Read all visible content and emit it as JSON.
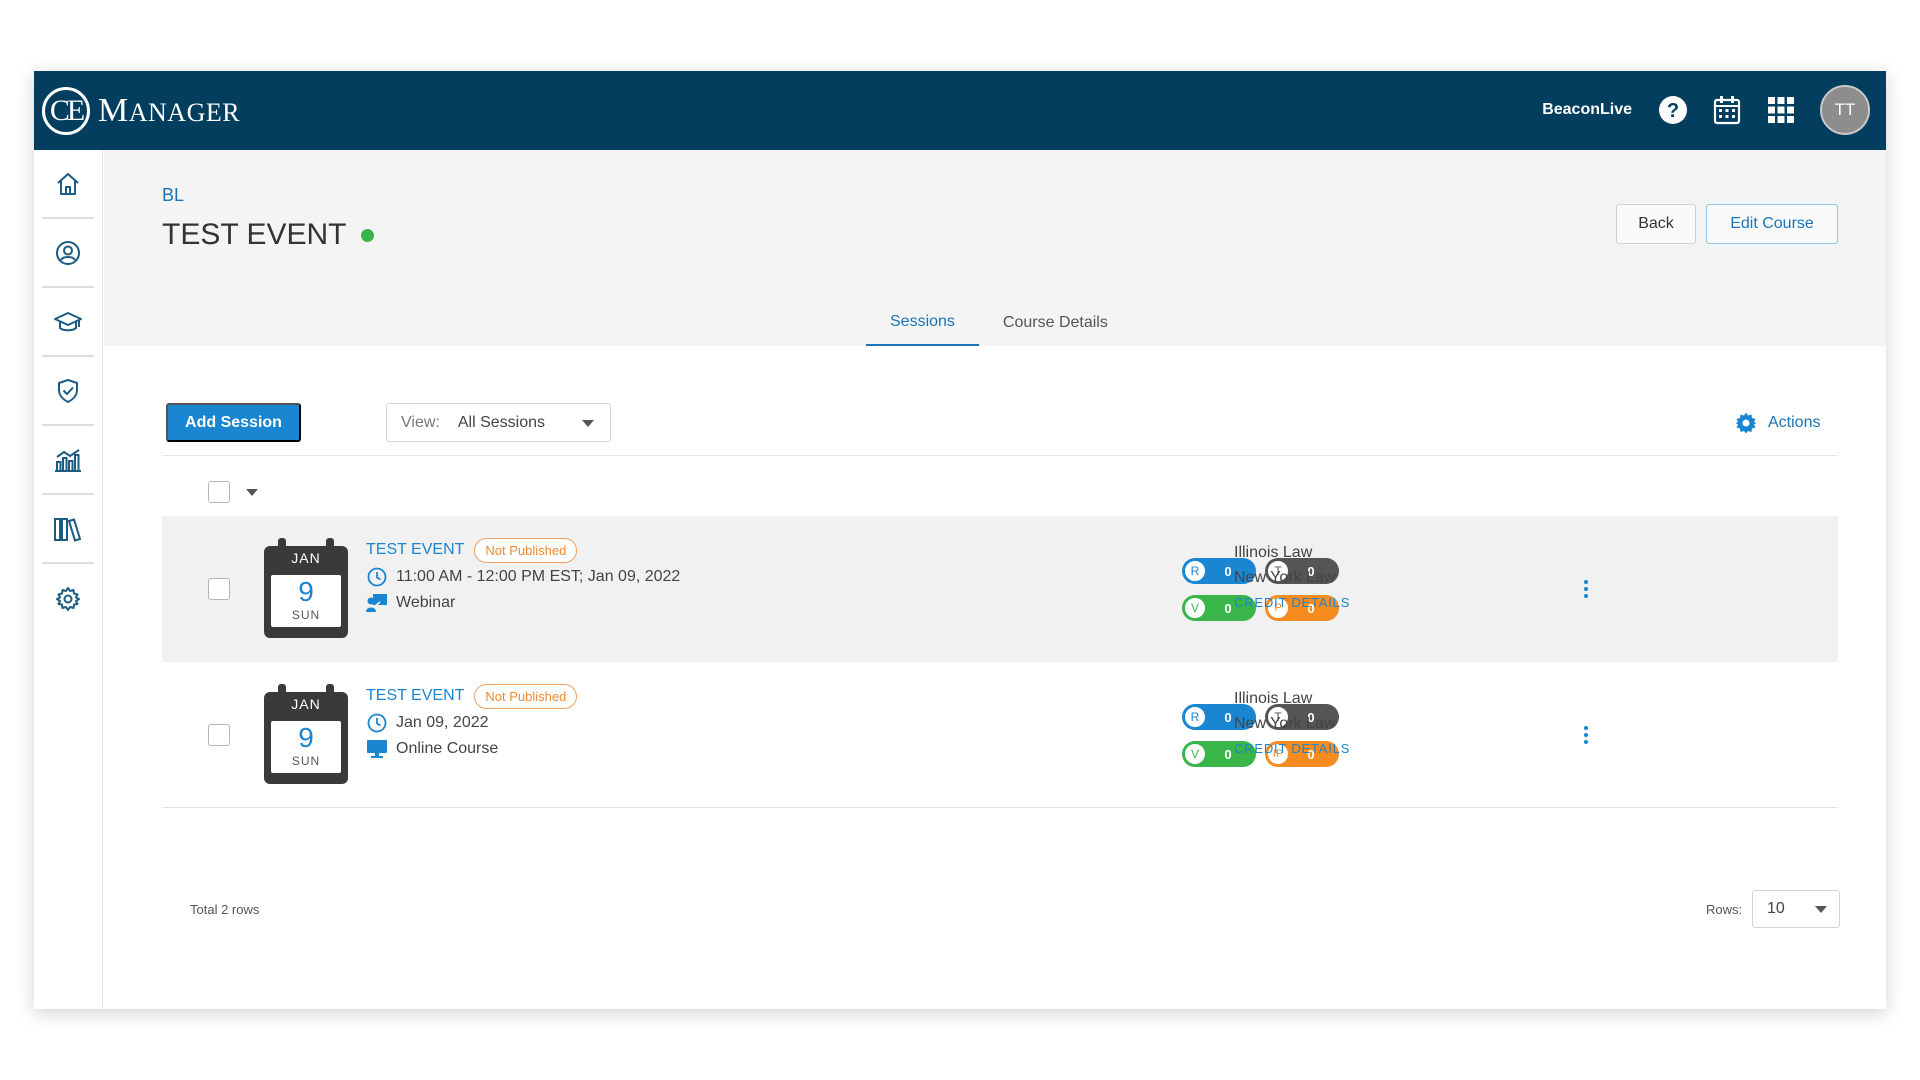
{
  "app": {
    "logo_mark": "CE",
    "logo_first": "M",
    "logo_rest": "ANAGER",
    "org_name": "BeaconLive",
    "avatar_initials": "TT",
    "icons": {
      "help": "help-circle-icon",
      "calendar": "calendar-icon",
      "apps": "apps-grid-icon"
    },
    "colors": {
      "navbar": "#033e5e",
      "accent": "#1a86d1",
      "status_active": "#3ab54a",
      "badge_orange": "#f08a32"
    }
  },
  "sidebar": {
    "items": [
      {
        "name": "home",
        "icon": "home-icon"
      },
      {
        "name": "users",
        "icon": "user-circle-icon"
      },
      {
        "name": "courses",
        "icon": "graduation-cap-icon"
      },
      {
        "name": "compliance",
        "icon": "shield-check-icon"
      },
      {
        "name": "reports",
        "icon": "chart-icon"
      },
      {
        "name": "library",
        "icon": "library-icon"
      },
      {
        "name": "settings",
        "icon": "gear-icon"
      }
    ]
  },
  "header": {
    "breadcrumb": "BL",
    "title": "TEST EVENT",
    "back_label": "Back",
    "edit_label": "Edit Course"
  },
  "tabs": [
    {
      "label": "Sessions",
      "active": true
    },
    {
      "label": "Course Details",
      "active": false
    }
  ],
  "toolbar": {
    "add_label": "Add Session",
    "view_label": "View:",
    "view_value": "All Sessions",
    "actions_label": "Actions"
  },
  "sessions": [
    {
      "month": "JAN",
      "day": "9",
      "weekday": "SUN",
      "title": "TEST EVENT",
      "status": "Not Published",
      "time": "11:00 AM - 12:00 PM  EST; Jan 09, 2022",
      "type": "Webinar",
      "counters": [
        {
          "letter": "R",
          "value": "0"
        },
        {
          "letter": "T",
          "value": "0"
        },
        {
          "letter": "V",
          "value": "0"
        },
        {
          "letter": "P",
          "value": "0"
        }
      ],
      "credits": [
        "Illinois Law",
        "New York Law"
      ],
      "credit_link": "CREDIT DETAILS"
    },
    {
      "month": "JAN",
      "day": "9",
      "weekday": "SUN",
      "title": "TEST EVENT",
      "status": "Not Published",
      "time": "Jan 09, 2022",
      "type": "Online Course",
      "counters": [
        {
          "letter": "R",
          "value": "0"
        },
        {
          "letter": "T",
          "value": "0"
        },
        {
          "letter": "V",
          "value": "0"
        },
        {
          "letter": "IP",
          "value": "0"
        }
      ],
      "credits": [
        "Illinois Law",
        "New York Law"
      ],
      "credit_link": "CREDIT DETAILS"
    }
  ],
  "footer": {
    "total": "Total 2 rows",
    "rows_label": "Rows:",
    "rows_value": "10"
  }
}
